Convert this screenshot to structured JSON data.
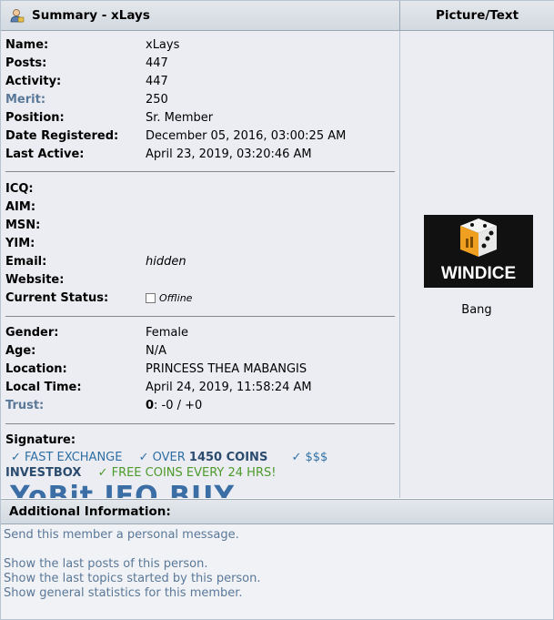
{
  "header": {
    "title": "Summary - xLays",
    "picture_title": "Picture/Text"
  },
  "profile": {
    "name": {
      "label": "Name:",
      "value": "xLays"
    },
    "posts": {
      "label": "Posts:",
      "value": "447"
    },
    "activity": {
      "label": "Activity:",
      "value": "447"
    },
    "merit": {
      "label": "Merit:",
      "value": "250"
    },
    "position": {
      "label": "Position:",
      "value": "Sr. Member"
    },
    "date_registered": {
      "label": "Date Registered:",
      "value": "December 05, 2016, 03:00:25 AM"
    },
    "last_active": {
      "label": "Last Active:",
      "value": "April 23, 2019, 03:20:46 AM"
    },
    "icq": {
      "label": "ICQ:",
      "value": ""
    },
    "aim": {
      "label": "AIM:",
      "value": ""
    },
    "msn": {
      "label": "MSN:",
      "value": ""
    },
    "yim": {
      "label": "YIM:",
      "value": ""
    },
    "email": {
      "label": "Email:",
      "value": "hidden"
    },
    "website": {
      "label": "Website:",
      "value": ""
    },
    "current_status": {
      "label": "Current Status:",
      "value": "Offline"
    },
    "gender": {
      "label": "Gender:",
      "value": "Female"
    },
    "age": {
      "label": "Age:",
      "value": "N/A"
    },
    "location": {
      "label": "Location:",
      "value": "PRINCESS THEA MABANGIS"
    },
    "local_time": {
      "label": "Local Time:",
      "value": "April 24, 2019, 11:58:24 AM"
    },
    "trust": {
      "label": "Trust:",
      "value_bold": "0",
      "value_rest": ": -0 / +0"
    }
  },
  "signature": {
    "label": "Signature:",
    "line1_a": "✓ FAST EXCHANGE",
    "line1_b_pre": "✓ OVER ",
    "line1_b_bold": "1450 COINS",
    "line1_c": "✓ $$$",
    "line2_a": "INVESTBOX",
    "line2_b": "✓ FREE COINS EVERY 24 HRS!",
    "line3": "YoBit IEO  BUY"
  },
  "picture": {
    "avatar_text": "WINDICE",
    "personal_text": "Bang"
  },
  "additional": {
    "title": "Additional Information:",
    "send_pm": "Send this member a personal message.",
    "last_posts": "Show the last posts of this person.",
    "last_topics": "Show the last topics started by this person.",
    "stats": "Show general statistics for this member."
  },
  "colors": {
    "link": "#5a7898",
    "header_bg": "#d8dee5",
    "panel_bg": "#ecedf3"
  },
  "icons": {
    "user": "user-icon",
    "status": "offline-checkbox-icon"
  }
}
